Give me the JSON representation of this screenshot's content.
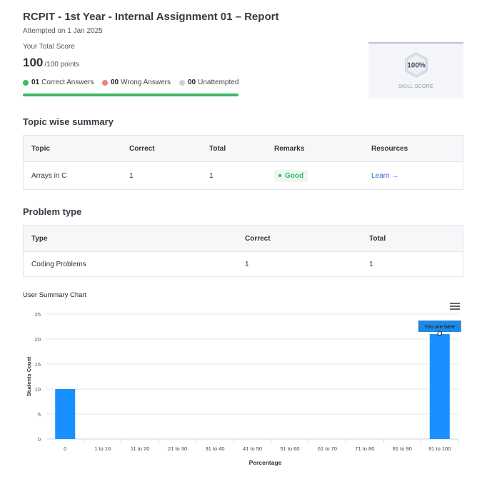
{
  "header": {
    "title": "RCPIT - 1st Year - Internal Assignment 01 – Report",
    "attempted": "Attempted on 1 Jan 2025"
  },
  "score": {
    "label": "Your Total Score",
    "value": "100",
    "suffix": "/100 points",
    "correct_count": "01",
    "correct_label": "Correct Answers",
    "wrong_count": "00",
    "wrong_label": "Wrong Answers",
    "unattempted_count": "00",
    "unattempted_label": "Unattempted",
    "progress_fraction": 1.0,
    "colors": {
      "correct": "#3cb964",
      "wrong": "#ec8080",
      "unattempted": "#cdd2dc"
    }
  },
  "skill": {
    "percent": "100%",
    "label": "SKILL SCORE"
  },
  "topic_summary": {
    "title": "Topic wise summary",
    "headers": [
      "Topic",
      "Correct",
      "Total",
      "Remarks",
      "Resources"
    ],
    "rows": [
      {
        "topic": "Arrays in C",
        "correct": "1",
        "total": "1",
        "remarks": "Good",
        "resource": "Learn →"
      }
    ]
  },
  "problem_type": {
    "title": "Problem type",
    "headers": [
      "Type",
      "Correct",
      "Total"
    ],
    "rows": [
      {
        "type": "Coding Problems",
        "correct": "1",
        "total": "1"
      }
    ]
  },
  "chart_title": "User Summary Chart",
  "chart_data": {
    "type": "bar",
    "categories": [
      "0",
      "1 to 10",
      "11 to 20",
      "21 to 30",
      "31 to 40",
      "41 to 50",
      "51 to 60",
      "61 to 70",
      "71 to 80",
      "81 to 90",
      "91 to 100"
    ],
    "values": [
      10,
      0,
      0,
      0,
      0,
      0,
      0,
      0,
      0,
      0,
      21
    ],
    "xlabel": "Percentage",
    "ylabel": "Students Count",
    "ylim": [
      0,
      25
    ],
    "yticks": [
      0,
      5,
      10,
      15,
      20,
      25
    ],
    "grid": true,
    "bar_color": "#1890ff",
    "annotation": {
      "category": "91 to 100",
      "text": "You are here",
      "color": "#1e88e5"
    }
  }
}
